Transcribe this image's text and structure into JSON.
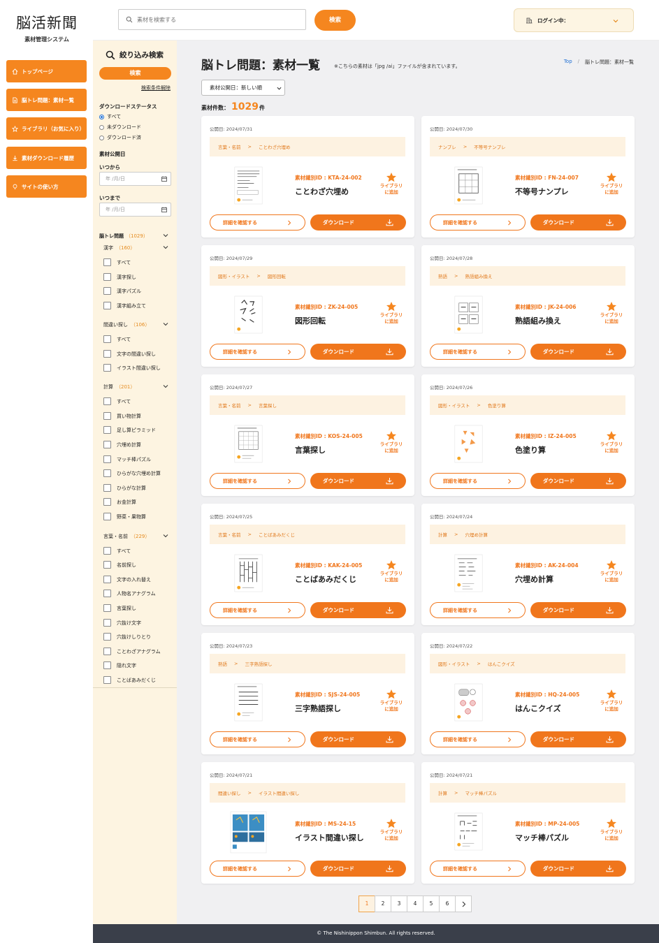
{
  "colors": {
    "accent": "#f5861f",
    "accent_dark": "#f0761c",
    "filter_bg": "#fdf4e1",
    "footer_bg": "#3a3f4a"
  },
  "logo": {
    "title": "脳活新聞",
    "subtitle": "素材管理システム"
  },
  "nav": [
    {
      "label": "トップページ",
      "icon": "home-icon"
    },
    {
      "label": "脳トレ問題：素材一覧",
      "icon": "document-icon"
    },
    {
      "label": "ライブラリ（お気に入り）",
      "icon": "star-icon"
    },
    {
      "label": "素材ダウンロード履歴",
      "icon": "download-icon"
    },
    {
      "label": "サイトの使い方",
      "icon": "lightbulb-icon"
    }
  ],
  "header": {
    "search_placeholder": "素材を検索する",
    "search_button": "検索",
    "login_label": "ログイン中："
  },
  "filter": {
    "title": "絞り込み検索",
    "search_button": "検索",
    "clear_label": "検索条件解除",
    "download_status": {
      "heading": "ダウンロードステータス",
      "options": [
        "すべて",
        "未ダウンロード",
        "ダウンロード済"
      ],
      "selected": "すべて"
    },
    "published": {
      "heading": "素材公開日",
      "from_label": "いつから",
      "to_label": "いつまで",
      "date_placeholder": "年 /月/日"
    },
    "category": {
      "name": "脳トレ問題",
      "count": "（1029）"
    },
    "groups": [
      {
        "name": "漢字",
        "count": "（160）",
        "items": [
          "すべて",
          "漢字探し",
          "漢字パズル",
          "漢字組み立て"
        ]
      },
      {
        "name": "間違い探し",
        "count": "（106）",
        "items": [
          "すべて",
          "文字の間違い探し",
          "イラスト間違い探し"
        ]
      },
      {
        "name": "計算",
        "count": "（201）",
        "items": [
          "すべて",
          "買い物計算",
          "足し算ピラミッド",
          "穴埋め計算",
          "マッチ棒パズル",
          "ひらがな穴埋め計算",
          "ひらがな計算",
          "お金計算",
          "野菜・果物算"
        ]
      },
      {
        "name": "言葉・名前",
        "count": "（229）",
        "items": [
          "すべて",
          "名前探し",
          "文字の入れ替え",
          "人物名アナグラム",
          "言葉探し",
          "穴抜け文字",
          "穴抜けしりとり",
          "ことわざアナグラム",
          "隠れ文字",
          "ことばあみだくじ"
        ]
      }
    ]
  },
  "main": {
    "title": "脳トレ問題：素材一覧",
    "note": "※こちらの素材は「jpg /ai」ファイルが含まれています。",
    "breadcrumb": {
      "top": "Top",
      "separator": "/",
      "current": "脳トレ問題：素材一覧"
    },
    "sort_value": "素材公開日：新しい順",
    "count_label": "素材件数：",
    "count": "1029",
    "count_unit": "件",
    "card_labels": {
      "id_prefix": "素材識別ID : ",
      "library_line1": "ライブラリ",
      "library_line2": "に追加",
      "detail": "詳細を確認する",
      "download": "ダウンロード",
      "date_prefix": "公開日: ",
      "crumb_sep": ">"
    },
    "cards": [
      {
        "date": "2024/07/31",
        "cat": "言葉・名前",
        "sub": "ことわざ穴埋め",
        "id": "KTA-24-002",
        "name": "ことわざ穴埋め"
      },
      {
        "date": "2024/07/30",
        "cat": "ナンプレ",
        "sub": "不等号ナンプレ",
        "id": "FN-24-007",
        "name": "不等号ナンプレ"
      },
      {
        "date": "2024/07/29",
        "cat": "図形・イラスト",
        "sub": "図形回転",
        "id": "ZK-24-005",
        "name": "図形回転"
      },
      {
        "date": "2024/07/28",
        "cat": "熟語",
        "sub": "熟語組み換え",
        "id": "JK-24-006",
        "name": "熟語組み換え"
      },
      {
        "date": "2024/07/27",
        "cat": "言葉・名前",
        "sub": "言葉探し",
        "id": "KOS-24-005",
        "name": "言葉探し"
      },
      {
        "date": "2024/07/26",
        "cat": "図形・イラスト",
        "sub": "色塗り算",
        "id": "IZ-24-005",
        "name": "色塗り算"
      },
      {
        "date": "2024/07/25",
        "cat": "言葉・名前",
        "sub": "ことばあみだくじ",
        "id": "KAK-24-005",
        "name": "ことばあみだくじ"
      },
      {
        "date": "2024/07/24",
        "cat": "計算",
        "sub": "穴埋め計算",
        "id": "AK-24-004",
        "name": "穴埋め計算"
      },
      {
        "date": "2024/07/23",
        "cat": "熟語",
        "sub": "三字熟語探し",
        "id": "SJS-24-005",
        "name": "三字熟語探し"
      },
      {
        "date": "2024/07/22",
        "cat": "図形・イラスト",
        "sub": "はんこクイズ",
        "id": "HQ-24-005",
        "name": "はんこクイズ"
      },
      {
        "date": "2024/07/21",
        "cat": "間違い探し",
        "sub": "イラスト間違い探し",
        "id": "MS-24-15",
        "name": "イラスト間違い探し"
      },
      {
        "date": "2024/07/21",
        "cat": "計算",
        "sub": "マッチ棒パズル",
        "id": "MP-24-005",
        "name": "マッチ棒パズル"
      }
    ]
  },
  "pagination": {
    "pages": [
      "1",
      "2",
      "3",
      "4",
      "5",
      "6"
    ],
    "current": "1"
  },
  "footer": {
    "text": "© The Nishinippon Shimbun. All rights reserved."
  }
}
